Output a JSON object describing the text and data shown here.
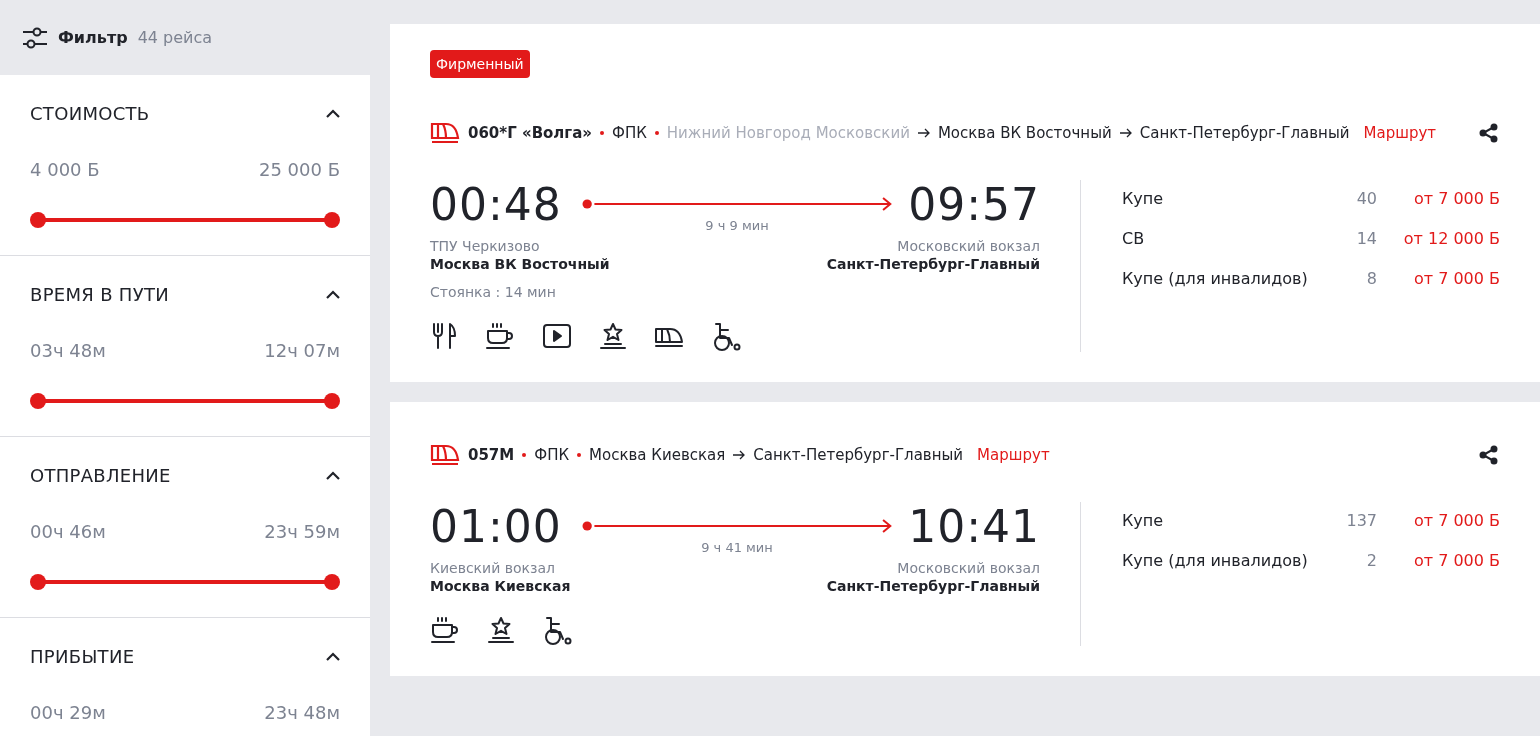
{
  "filter": {
    "title": "Фильтр",
    "count": "44 рейса"
  },
  "sections": [
    {
      "title": "СТОИМОСТЬ",
      "expanded": true,
      "min": "4 000 Б",
      "max": "25 000 Б",
      "thumbs": [
        {
          "level": 0
        },
        {
          "level": 1
        }
      ]
    },
    {
      "title": "ВРЕМЯ В ПУТИ",
      "expanded": true,
      "min": "03ч 48м",
      "max": "12ч 07м",
      "thumbs": [
        {
          "level": 0
        },
        {
          "level": 1
        }
      ]
    },
    {
      "title": "ОТПРАВЛЕНИЕ",
      "expanded": true,
      "min": "00ч 46м",
      "max": "23ч 59м",
      "thumbs": [
        {
          "level": 0
        },
        {
          "level": 1
        }
      ]
    },
    {
      "title": "ПРИБЫТИЕ",
      "expanded": true,
      "min": "00ч 29м",
      "max": "23ч 48м"
    }
  ],
  "trains": [
    {
      "badge": "Фирменный",
      "number": "060*Г «Волга»",
      "carrier": "ФПК",
      "stops": [
        {
          "name": "Нижний Новгород Московский",
          "passed": true
        },
        {
          "name": "Москва ВК Восточный",
          "passed": false
        },
        {
          "name": "Санкт-Петербург-Главный",
          "passed": false
        }
      ],
      "route_link": "Маршрут",
      "depart": {
        "time": "00:48",
        "station": "ТПУ Черкизово",
        "city": "Москва ВК Восточный"
      },
      "duration": "9 ч 9 мин",
      "arrive": {
        "time": "09:57",
        "station": "Московский вокзал",
        "city": "Санкт-Петербург-Главный"
      },
      "stop_note": "Стоянка : 14 мин",
      "amenities": [
        {
          "kind": "food"
        },
        {
          "kind": "coffee"
        },
        {
          "kind": "video"
        },
        {
          "kind": "star"
        },
        {
          "kind": "train"
        },
        {
          "kind": "wheelchair"
        }
      ],
      "fares": [
        {
          "class": "Купе",
          "seats": "40",
          "price": "от 7 000 Б"
        },
        {
          "class": "СВ",
          "seats": "14",
          "price": "от 12 000 Б"
        },
        {
          "class": "Купе (для инвалидов)",
          "seats": "8",
          "price": "от 7 000 Б"
        }
      ]
    },
    {
      "number": "057М",
      "carrier": "ФПК",
      "stops": [
        {
          "name": "Москва Киевская",
          "passed": false
        },
        {
          "name": "Санкт-Петербург-Главный",
          "passed": false
        }
      ],
      "route_link": "Маршрут",
      "depart": {
        "time": "01:00",
        "station": "Киевский вокзал",
        "city": "Москва Киевская"
      },
      "duration": "9 ч 41 мин",
      "arrive": {
        "time": "10:41",
        "station": "Московский вокзал",
        "city": "Санкт-Петербург-Главный"
      },
      "amenities": [
        {
          "kind": "coffee"
        },
        {
          "kind": "star"
        },
        {
          "kind": "wheelchair"
        }
      ],
      "fares": [
        {
          "class": "Купе",
          "seats": "137",
          "price": "от 7 000 Б"
        },
        {
          "class": "Купе (для инвалидов)",
          "seats": "2",
          "price": "от 7 000 Б"
        }
      ]
    }
  ]
}
